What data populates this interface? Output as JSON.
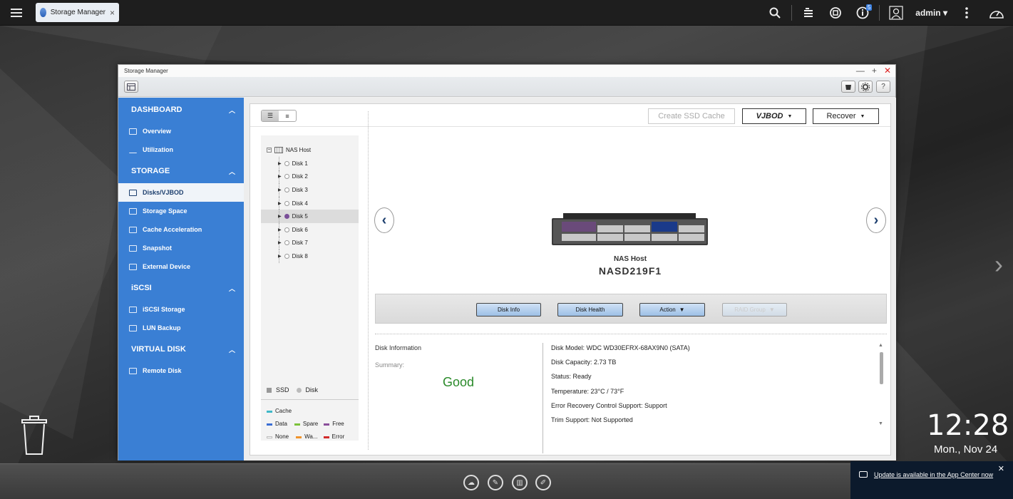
{
  "topbar": {
    "app_tab_label": "Storage Manager",
    "tab_close": "×",
    "notification_count": "5",
    "user": "admin ▾"
  },
  "window": {
    "title": "Storage Manager",
    "minimize": "—",
    "maximize": "+",
    "close": "✕"
  },
  "sidebar": {
    "sections": [
      {
        "title": "DASHBOARD",
        "items": [
          "Overview",
          "Utilization"
        ]
      },
      {
        "title": "STORAGE",
        "items": [
          "Disks/VJBOD",
          "Storage Space",
          "Cache Acceleration",
          "Snapshot",
          "External Device"
        ]
      },
      {
        "title": "iSCSI",
        "items": [
          "iSCSI Storage",
          "LUN Backup"
        ]
      },
      {
        "title": "VIRTUAL DISK",
        "items": [
          "Remote Disk"
        ]
      }
    ],
    "active_item": "Disks/VJBOD"
  },
  "toolbar": {
    "create_ssd_cache": "Create SSD Cache",
    "vjbod": "VJBOD",
    "recover": "Recover"
  },
  "tree": {
    "root": "NAS Host",
    "disks": [
      "Disk 1",
      "Disk 2",
      "Disk 3",
      "Disk 4",
      "Disk 5",
      "Disk 6",
      "Disk 7",
      "Disk 8"
    ],
    "selected": "Disk 5"
  },
  "legend": {
    "ssd": "SSD",
    "disk": "Disk",
    "cache": "Cache",
    "data": "Data",
    "spare": "Spare",
    "free": "Free",
    "none": "None",
    "warning": "Wa...",
    "error": "Error"
  },
  "host": {
    "label": "NAS Host",
    "name": "NASD219F1"
  },
  "actions": {
    "disk_info": "Disk Info",
    "disk_health": "Disk Health",
    "action": "Action",
    "raid_group": "RAID Group"
  },
  "disk_info": {
    "section_label": "Disk Information",
    "summary_label": "Summary:",
    "summary_value": "Good",
    "details": [
      "Disk Model: WDC WD30EFRX-68AX9N0 (SATA)",
      "Disk Capacity: 2.73 TB",
      "Status: Ready",
      "Temperature: 23°C / 73°F",
      "Error Recovery Control Support: Support",
      "Trim Support: Not Supported"
    ]
  },
  "desktop": {
    "time": "12:28",
    "date": "Mon., Nov 24"
  },
  "notification": {
    "text": "Update is available in the App Center now",
    "close": "✕"
  },
  "colors": {
    "sidebar_blue": "#3a7fd4",
    "good_green": "#2a8a2a",
    "selected_disk": "#7a4f99",
    "cache": "#3fb8c8",
    "data": "#3a6ed4",
    "spare": "#7cc23a",
    "free": "#8a4f9a",
    "none": "#ffffff",
    "warning": "#f0932a",
    "error": "#d22a2a"
  }
}
